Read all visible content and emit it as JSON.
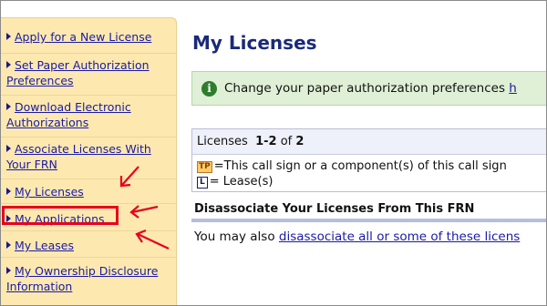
{
  "sidebar": {
    "items": [
      {
        "label": "Apply for a New License"
      },
      {
        "label": "Set Paper Authorization Preferences"
      },
      {
        "label": "Download Electronic Authorizations"
      },
      {
        "label": "Associate Licenses With Your FRN"
      },
      {
        "label": "My Licenses"
      },
      {
        "label": "My Applications"
      },
      {
        "label": "My Leases"
      },
      {
        "label": "My Ownership Disclosure Information"
      }
    ]
  },
  "main": {
    "title": "My Licenses",
    "notice": {
      "text": "Change your paper authorization preferences ",
      "link": "h"
    },
    "licenses": {
      "label": "Licenses",
      "range": "1-2",
      "of_word": "of",
      "total": "2",
      "legend_tp_badge": "TP",
      "legend_tp_text": "=This call sign or a component(s) of this call sign",
      "legend_l_badge": "L",
      "legend_l_text": "= Lease(s)"
    },
    "disassociate": {
      "title": "Disassociate Your Licenses From This FRN",
      "prefix": "You may also ",
      "link": "disassociate all or some of these licens"
    }
  },
  "colors": {
    "sidebar_bg": "#fde9b0",
    "link": "#1a1aa6",
    "title": "#1a2a7a",
    "highlight": "#e8001c",
    "notice_bg": "#dff0d6"
  }
}
